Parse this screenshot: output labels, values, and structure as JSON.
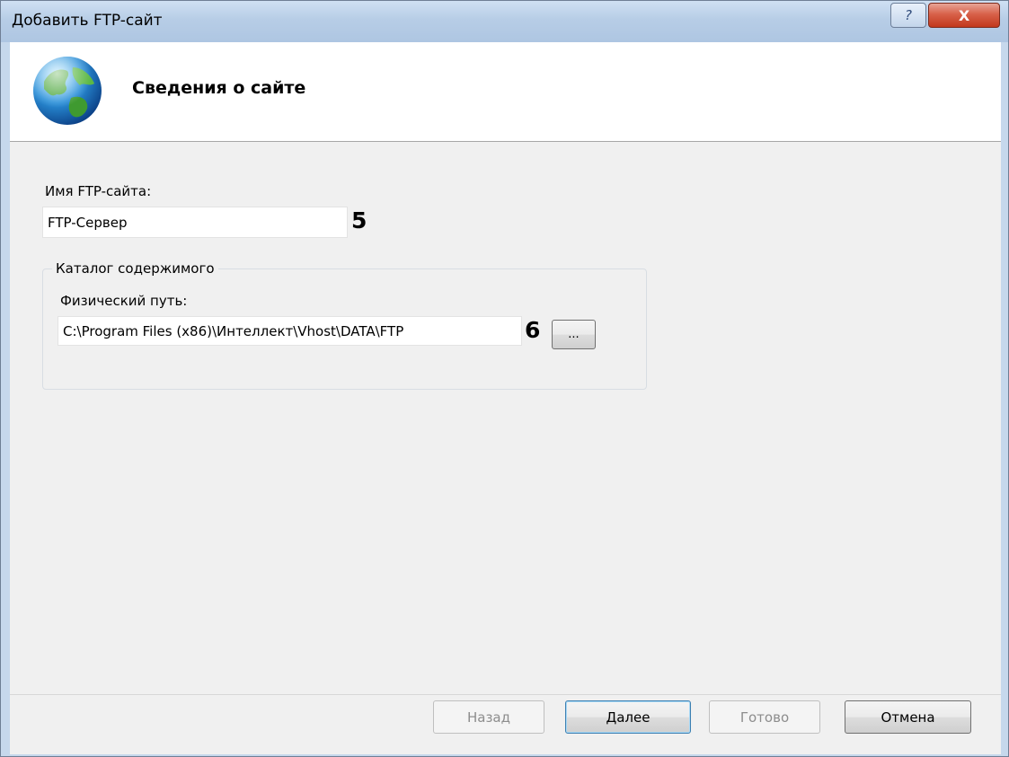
{
  "window": {
    "title": "Добавить FTP-сайт",
    "help_glyph": "?",
    "close_glyph": "X"
  },
  "header": {
    "title": "Сведения о сайте",
    "icon": "globe-icon"
  },
  "site_name": {
    "label": "Имя FTP-сайта:",
    "value": "FTP-Сервер",
    "marker": "5"
  },
  "content_dir": {
    "group_title": "Каталог содержимого",
    "path_label": "Физический путь:",
    "path_value": "C:\\Program Files (x86)\\Интеллект\\Vhost\\DATA\\FTP",
    "marker": "6",
    "browse_label": "..."
  },
  "footer": {
    "back_label": "Назад",
    "next_label": "Далее",
    "finish_label": "Готово",
    "cancel_label": "Отмена"
  },
  "colors": {
    "title_bar": "#b7cde6",
    "close_button": "#c2381c",
    "dialog_body": "#f0f0f0",
    "header_band": "#ffffff"
  }
}
